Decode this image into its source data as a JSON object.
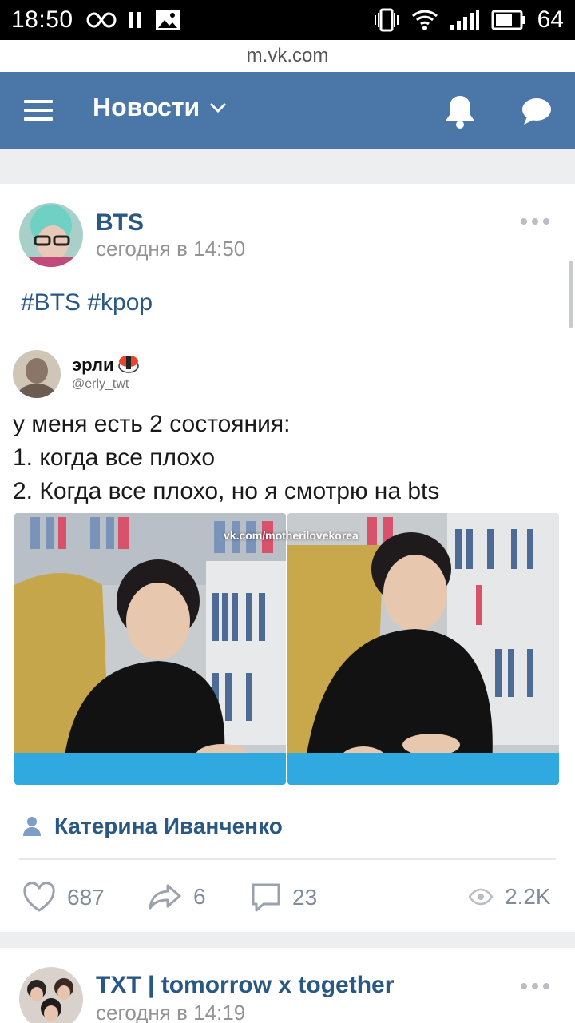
{
  "status_bar": {
    "time": "18:50",
    "battery": "64"
  },
  "url": "m.vk.com",
  "header": {
    "title": "Новости"
  },
  "post": {
    "group_name": "BTS",
    "time": "сегодня в 14:50",
    "hashtags": "#BTS #kpop",
    "tweet": {
      "name": "эрли",
      "handle": "@erly_twt",
      "lines": [
        "у меня есть 2 состояния:",
        "1. когда все плохо",
        "2. Когда все плохо, но я смотрю на bts"
      ],
      "watermark": "vk.com/motherilovekorea"
    },
    "author": "Катерина Иванченко",
    "likes": "687",
    "shares": "6",
    "comments": "23",
    "views": "2.2K"
  },
  "next_post": {
    "group_name": "TXT | tomorrow x together",
    "time": "сегодня в 14:19"
  },
  "colors": {
    "accent": "#4a76a8",
    "link": "#2a5885",
    "muted": "#939393"
  }
}
